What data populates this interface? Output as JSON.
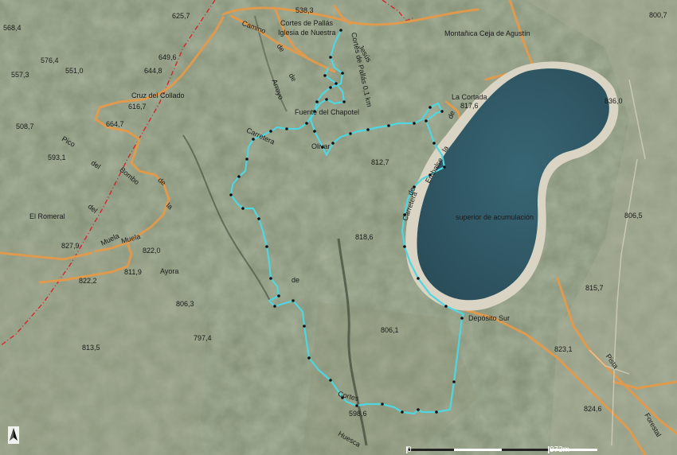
{
  "map": {
    "colors": {
      "terrain": "#7f8b70",
      "road": "#e39a4b",
      "route": "#4fd6e0",
      "reservoir_water": "#2f5664",
      "reservoir_rim": "#d9d4c4",
      "boundary": "#d4252b"
    },
    "spot_heights": [
      "568,4",
      "625,7",
      "538,3",
      "800,7",
      "576,4",
      "649,6",
      "557,3",
      "551,0",
      "644,8",
      "616,7",
      "508,7",
      "664,7",
      "593,1",
      "817,6",
      "836,0",
      "812,7",
      "806,5",
      "818,6",
      "827,9",
      "822,0",
      "811,9",
      "822,2",
      "815,7",
      "806,3",
      "797,4",
      "806,1",
      "813,5",
      "823,1",
      "824,6",
      "598,6"
    ],
    "places": [
      "Cortes de Pallás",
      "Iglesia de Nuestra",
      "Montañica Ceja de Agustín",
      "Cruz del Collado",
      "La Cortada",
      "Fuente del Chapotel",
      "Olivar",
      "El Romeral",
      "Ayora",
      "Depósito Sur",
      "superior de acumulación"
    ],
    "road_labels": [
      "Camino",
      "de",
      "Jesús",
      "Cortes de Pallás 0,1 km",
      "Arroyo",
      "de",
      "Pico",
      "del",
      "Bombo",
      "de",
      "la",
      "Muela",
      "Carretera",
      "de",
      "Carretera",
      "de",
      "Embalse",
      "la",
      "de",
      "Cortes",
      "Huesca",
      "Pista",
      "Forestal",
      "del",
      "Muela"
    ],
    "scale": {
      "start": "0",
      "end": "873m"
    },
    "icons": {
      "north_arrow": "north-arrow-icon"
    }
  }
}
